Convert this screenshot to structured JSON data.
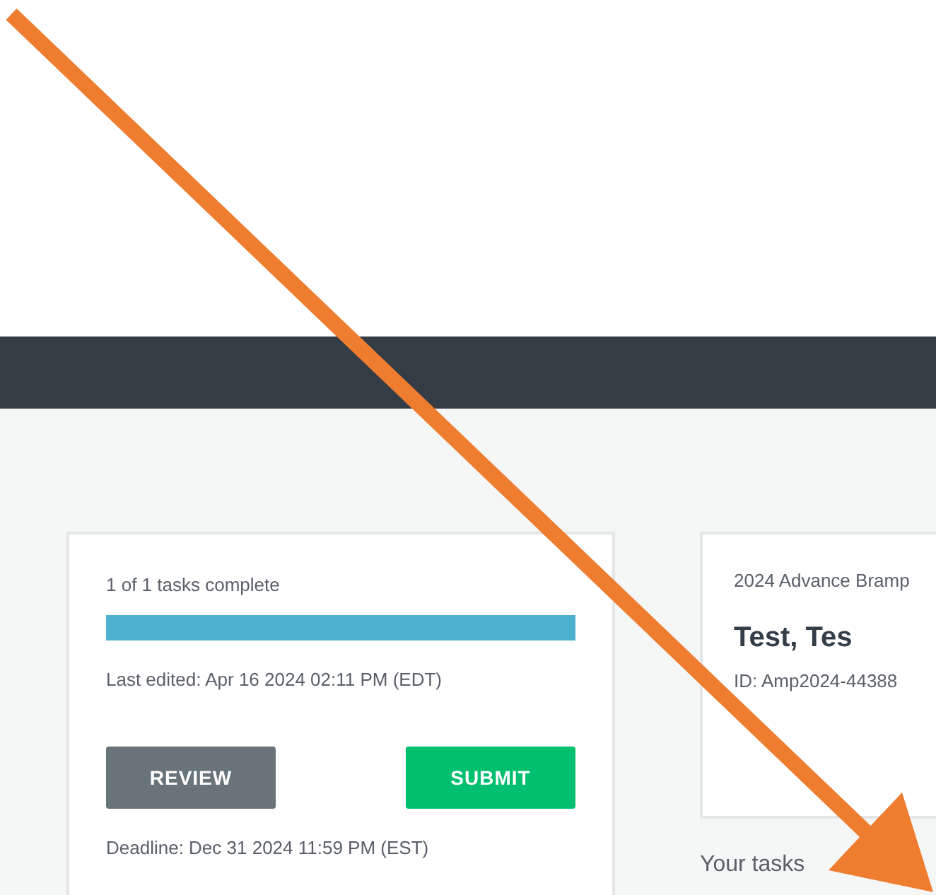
{
  "progress": {
    "label": "1 of 1 tasks complete",
    "level": 1.0
  },
  "last_edited": "Last edited: Apr 16 2024 02:11 PM (EDT)",
  "buttons": [
    {
      "label": "REVIEW",
      "kind": "secondary"
    },
    {
      "label": "SUBMIT",
      "kind": "primary"
    }
  ],
  "deadline": "Deadline: Dec 31 2024 11:59 PM (EST)",
  "applicant": {
    "program": "2024 Advance Bramp",
    "name": "Test, Tes",
    "id": "ID: Amp2024-44388"
  },
  "section_title": "Your tasks"
}
